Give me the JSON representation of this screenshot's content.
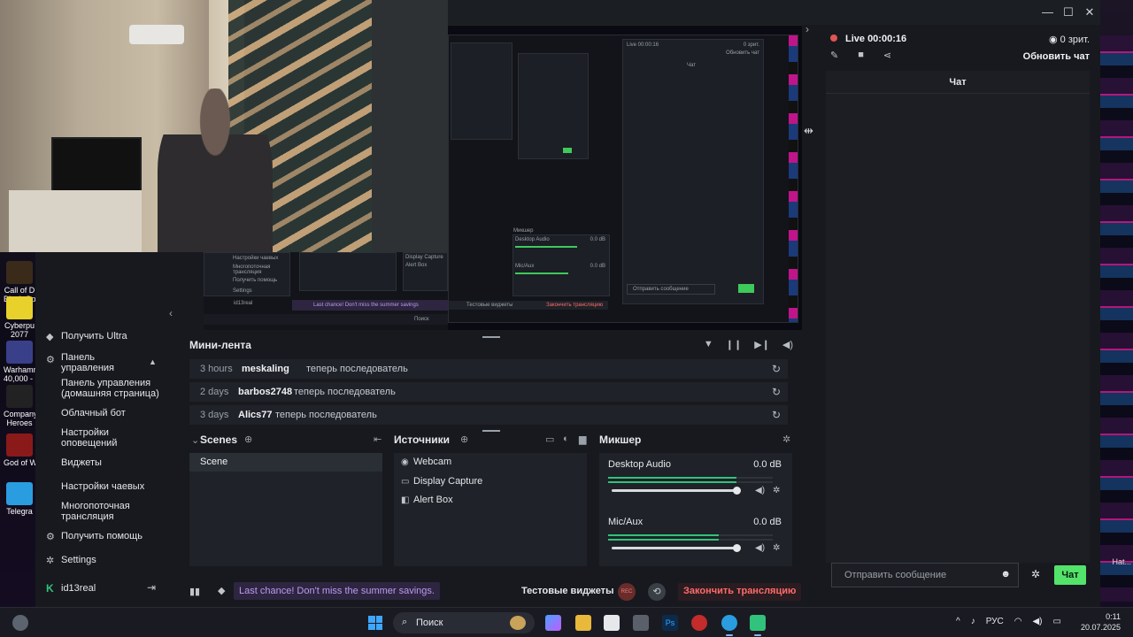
{
  "desktop": {
    "icons": [
      {
        "label": "Call of D\nBlack Op",
        "color": "#3a2a1a"
      },
      {
        "label": "Cyberpu\n2077",
        "color": "#e8d12a"
      },
      {
        "label": "Warhamm\n40,000 - I",
        "color": "#3a3f8a"
      },
      {
        "label": "Company\nHeroes",
        "color": "#222"
      },
      {
        "label": "God of W",
        "color": "#8a1a1a"
      },
      {
        "label": "Telegra",
        "color": "#2a9de0"
      }
    ],
    "right_label": "Hat..."
  },
  "window": {
    "minimize": "—",
    "maximize": "☐",
    "close": "✕"
  },
  "sidebar": {
    "items": [
      {
        "label": "Получить Ultra",
        "icon": "gem-icon"
      },
      {
        "label": "Панель управления",
        "icon": "dashboard-icon"
      },
      {
        "label": "Панель управления (домашняя страница)"
      },
      {
        "label": "Облачный бот"
      },
      {
        "label": "Настройки оповещений"
      },
      {
        "label": "Виджеты"
      },
      {
        "label": "Настройки чаевых"
      },
      {
        "label": "Многопоточная трансляция"
      },
      {
        "label": "Получить помощь",
        "icon": "help-icon"
      },
      {
        "label": "Settings",
        "icon": "gear-icon"
      }
    ],
    "username": "id13real"
  },
  "minifeed": {
    "title": "Мини-лента",
    "rows": [
      {
        "time": "3 hours",
        "user": "meskaling",
        "action": "теперь последователь"
      },
      {
        "time": "2 days",
        "user": "barbos2748",
        "action": "теперь последователь"
      },
      {
        "time": "3 days",
        "user": "Alics77",
        "action": "теперь последователь"
      }
    ]
  },
  "scenes": {
    "title": "Scenes",
    "items": [
      "Scene"
    ]
  },
  "sources": {
    "title": "Источники",
    "items": [
      "Webcam",
      "Display Capture",
      "Alert Box"
    ]
  },
  "mixer": {
    "title": "Микшер",
    "channels": [
      {
        "name": "Desktop Audio",
        "db": "0.0 dB",
        "level": 0.78,
        "volume": 1.0
      },
      {
        "name": "Mic/Aux",
        "db": "0.0 dB",
        "level": 0.67,
        "volume": 1.0
      }
    ]
  },
  "bottombar": {
    "promo": "Last chance! Don't miss the summer savings.",
    "test_widgets": "Тестовые виджеты",
    "rec": "REC",
    "end_stream": "Закончить трансляцию"
  },
  "chat": {
    "live": "Live 00:00:16",
    "viewers": "0 зрит.",
    "refresh": "Обновить чат",
    "header": "Чат",
    "placeholder": "Отправить сообщение",
    "send": "Чат"
  },
  "taskbar": {
    "search": "Поиск",
    "lang": "РУС",
    "time": "0:11",
    "date": "20.07.2025"
  },
  "preview": {
    "live": "Live 00:00:16",
    "viewers": "0 зрит.",
    "refresh": "Обновить чат",
    "chat": "Чат",
    "mixer": "Микшер",
    "desktop_audio": "Desktop Audio",
    "mic": "Mic/Aux",
    "display_capture": "Display Capture",
    "alert_box": "Alert Box",
    "send_placeholder": "Отправить сообщение",
    "promo": "Last chance! Don't miss the summer savings",
    "test": "Тестовые виджеты",
    "end": "Закончить трансляцию",
    "search": "Поиск",
    "menu1": "Настройки чаевых",
    "menu2": "Многопоточная трансляция",
    "menu3": "Получить помощь",
    "menu4": "Settings",
    "user": "id13real",
    "db": "0.0 dB"
  }
}
